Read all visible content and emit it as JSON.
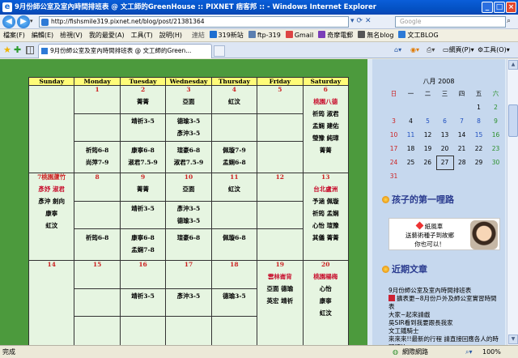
{
  "window": {
    "title": "9月份師公室及室內時間排班表 @ 文工師的GreenHouse :: PIXNET 痞客邦 :: - Windows Internet Explorer"
  },
  "address": {
    "url": "http://fishsmile319.pixnet.net/blog/post/21381364",
    "search_placeholder": "Google"
  },
  "menu": [
    "檔案(F)",
    "編輯(E)",
    "檢視(V)",
    "我的最愛(A)",
    "工具(T)",
    "說明(H)"
  ],
  "links": {
    "label": "連結",
    "items": [
      {
        "label": "319新站",
        "color": "#1e6fd0"
      },
      {
        "label": "ftp-319",
        "color": "#5b7fb0"
      },
      {
        "label": "Gmail",
        "color": "#d44"
      },
      {
        "label": "奇摩電郵",
        "color": "#7b3fb8"
      },
      {
        "label": "無名blog",
        "color": "#555"
      },
      {
        "label": "文工BLOG",
        "color": "#2d7ad6"
      }
    ]
  },
  "tab": {
    "label": "9月份師公室及室內時間排班表 @ 文工師的Green..."
  },
  "commands": {
    "page": "網頁(P)",
    "tools": "工具(O)"
  },
  "schedule": {
    "headers": [
      "Sunday",
      "Monday",
      "Tuesday",
      "Wednesday",
      "Thursday",
      "Friday",
      "Saturday"
    ],
    "weeks": [
      [
        {
          "day": "",
          "am": [],
          "mid": [],
          "pm": []
        },
        {
          "day": "1",
          "am": [],
          "mid": [],
          "pm": [
            "祈筠6-8",
            "尚萍7-9"
          ]
        },
        {
          "day": "2",
          "am": [
            "菁菁"
          ],
          "mid": [
            "靖祈3-5"
          ],
          "pm": [
            "康寧6-8",
            "淑君7.5-9"
          ]
        },
        {
          "day": "3",
          "am": [
            "亞面"
          ],
          "mid": [
            "德瑜3-5",
            "彥沖3-5"
          ],
          "pm": [
            "瑄豪6-8",
            "淑君7.5-9"
          ]
        },
        {
          "day": "4",
          "am": [
            "虹汶"
          ],
          "mid": [],
          "pm": [
            "佩璇7-9",
            "孟娴6-8"
          ]
        },
        {
          "day": "5",
          "am": [],
          "mid": [],
          "pm": []
        },
        {
          "day": "6",
          "am": [
            "桃園八德",
            "祈筠 淑君",
            "孟娴 建佑",
            "瑩豫 純璋",
            "菁菁"
          ],
          "mid": [],
          "pm": [],
          "red_first": true
        }
      ],
      [
        {
          "day": "7桃園蘆竹",
          "am": [
            "彥妤 淑君",
            "彥沖 劍向",
            "康寧",
            "虹汶"
          ],
          "mid": [],
          "pm": [],
          "red_first": true
        },
        {
          "day": "8",
          "am": [],
          "mid": [],
          "pm": [
            "祈筠6-8"
          ]
        },
        {
          "day": "9",
          "am": [
            "菁菁"
          ],
          "mid": [
            "靖祈3-5"
          ],
          "pm": [
            "康寧6-8",
            "孟娴7-8"
          ]
        },
        {
          "day": "10",
          "am": [
            "亞面"
          ],
          "mid": [
            "彥沖3-5",
            "德瑜3-5"
          ],
          "pm": [
            "瑄豪6-8"
          ]
        },
        {
          "day": "11",
          "am": [
            "虹汶"
          ],
          "mid": [],
          "pm": [
            "佩璇6-8"
          ]
        },
        {
          "day": "12",
          "am": [],
          "mid": [],
          "pm": []
        },
        {
          "day": "13",
          "am": [
            "台北盧洲",
            "予涵 佩璇",
            "祈筠 孟娴",
            "心怡 瑄豫",
            "其儀 菁菁"
          ],
          "mid": [],
          "pm": [],
          "red_second": true
        }
      ],
      [
        {
          "day": "14",
          "am": [],
          "mid": [],
          "pm": []
        },
        {
          "day": "15",
          "am": [],
          "mid": [],
          "pm": []
        },
        {
          "day": "16",
          "am": [],
          "mid": [
            "靖祈3-5"
          ],
          "pm": []
        },
        {
          "day": "17",
          "am": [],
          "mid": [
            "彥沖3-5"
          ],
          "pm": []
        },
        {
          "day": "18",
          "am": [],
          "mid": [
            "德瑜3-5"
          ],
          "pm": []
        },
        {
          "day": "19",
          "am": [
            "雲林崙背",
            "亞面 德瑜",
            "英宏 靖祈"
          ],
          "mid": [],
          "pm": [],
          "red_second": true
        },
        {
          "day": "20",
          "am": [
            "桃園楊梅",
            "心怡",
            "康寧",
            "虹汶"
          ],
          "mid": [],
          "pm": [],
          "red_second": true
        }
      ]
    ]
  },
  "calendar": {
    "title": "八月 2008",
    "weekdays": [
      "日",
      "一",
      "二",
      "三",
      "四",
      "五",
      "六"
    ],
    "rows": [
      [
        "",
        "",
        "",
        "",
        "",
        "1",
        "2"
      ],
      [
        "3",
        "4",
        "5",
        "6",
        "7",
        "8",
        "9"
      ],
      [
        "10",
        "11",
        "12",
        "13",
        "14",
        "15",
        "16"
      ],
      [
        "17",
        "18",
        "19",
        "20",
        "21",
        "22",
        "23"
      ],
      [
        "24",
        "25",
        "26",
        "27",
        "28",
        "29",
        "30"
      ],
      [
        "31",
        "",
        "",
        "",
        "",
        "",
        ""
      ]
    ],
    "today": "27"
  },
  "sidebar": {
    "section1": "孩子的第一哩路",
    "banner": {
      "line1": "紙風車",
      "line2": "送藝術種子到故鄉",
      "line3": "你也可以！"
    },
    "section2": "近期文章",
    "recent": [
      "9月份師公室及室內時間排班表",
      "擴表更~8月份戶外及師公室實習時間表",
      "大家~起來請戲",
      "吳SIR看到我要跟長我家",
      "文工鐵騎士",
      "來來來!!最新的行程 請直接回應各人的時間吧!!"
    ]
  },
  "status": {
    "left": "完成",
    "zone": "網際網路",
    "zoom": "100%"
  }
}
